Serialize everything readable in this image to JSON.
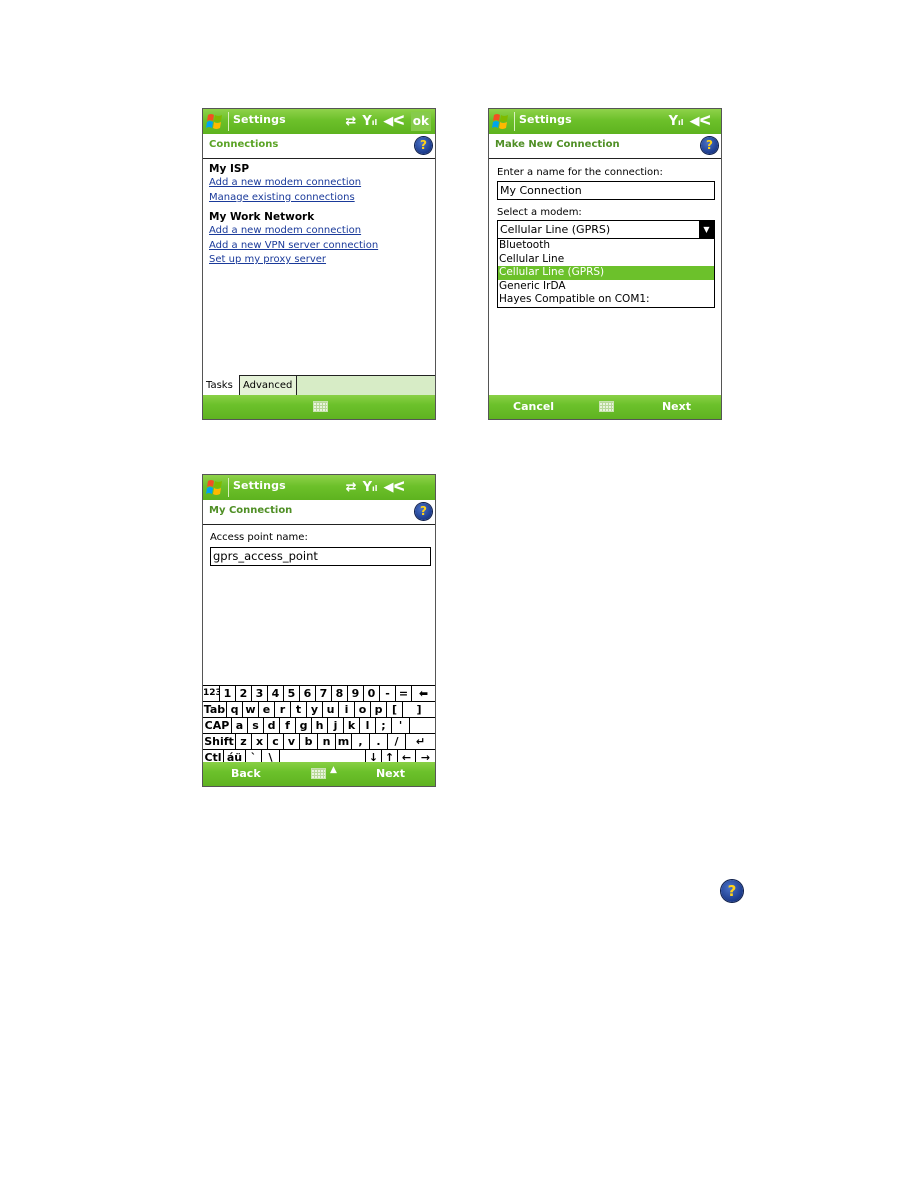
{
  "screens": [
    {
      "title": "Settings",
      "status_icons": [
        "sync-icon",
        "signal-icon",
        "volume-icon"
      ],
      "ok_label": "ok",
      "subheader": "Connections",
      "groups": [
        {
          "title": "My ISP",
          "links": [
            "Add a new modem connection",
            "Manage existing connections"
          ]
        },
        {
          "title": "My Work Network",
          "links": [
            "Add a new modem connection",
            "Add a new VPN server connection",
            "Set up my proxy server"
          ]
        }
      ],
      "tabs": [
        "Tasks",
        "Advanced"
      ],
      "active_tab": "Tasks"
    },
    {
      "title": "Settings",
      "status_icons": [
        "signal-icon",
        "volume-icon"
      ],
      "subheader": "Make New Connection",
      "name_label": "Enter a name for the connection:",
      "name_value": "My Connection",
      "modem_label": "Select a modem:",
      "modem_selected": "Cellular Line (GPRS)",
      "modem_options": [
        "Bluetooth",
        "Cellular Line",
        "Cellular Line (GPRS)",
        "Generic IrDA",
        "Hayes Compatible on COM1:"
      ],
      "softkey_left": "Cancel",
      "softkey_right": "Next"
    },
    {
      "title": "Settings",
      "status_icons": [
        "sync-icon",
        "signal-icon",
        "volume-icon"
      ],
      "subheader": "My Connection",
      "apn_label": "Access point name:",
      "apn_value": "gprs_access_point",
      "keyboard": [
        [
          "123",
          "1",
          "2",
          "3",
          "4",
          "5",
          "6",
          "7",
          "8",
          "9",
          "0",
          "-",
          "=",
          "⬅"
        ],
        [
          "Tab",
          "q",
          "w",
          "e",
          "r",
          "t",
          "y",
          "u",
          "i",
          "o",
          "p",
          "[",
          "]"
        ],
        [
          "CAP",
          "a",
          "s",
          "d",
          "f",
          "g",
          "h",
          "j",
          "k",
          "l",
          ";",
          "'"
        ],
        [
          "Shift",
          "z",
          "x",
          "c",
          "v",
          "b",
          "n",
          "m",
          ",",
          ".",
          "/",
          "↵"
        ],
        [
          "Ctl",
          "áü",
          "`",
          "\\",
          " ",
          "↓",
          "↑",
          "←",
          "→"
        ]
      ],
      "softkey_left": "Back",
      "softkey_right": "Next"
    }
  ],
  "standalone_icon": "help-icon",
  "help_glyph": "?"
}
